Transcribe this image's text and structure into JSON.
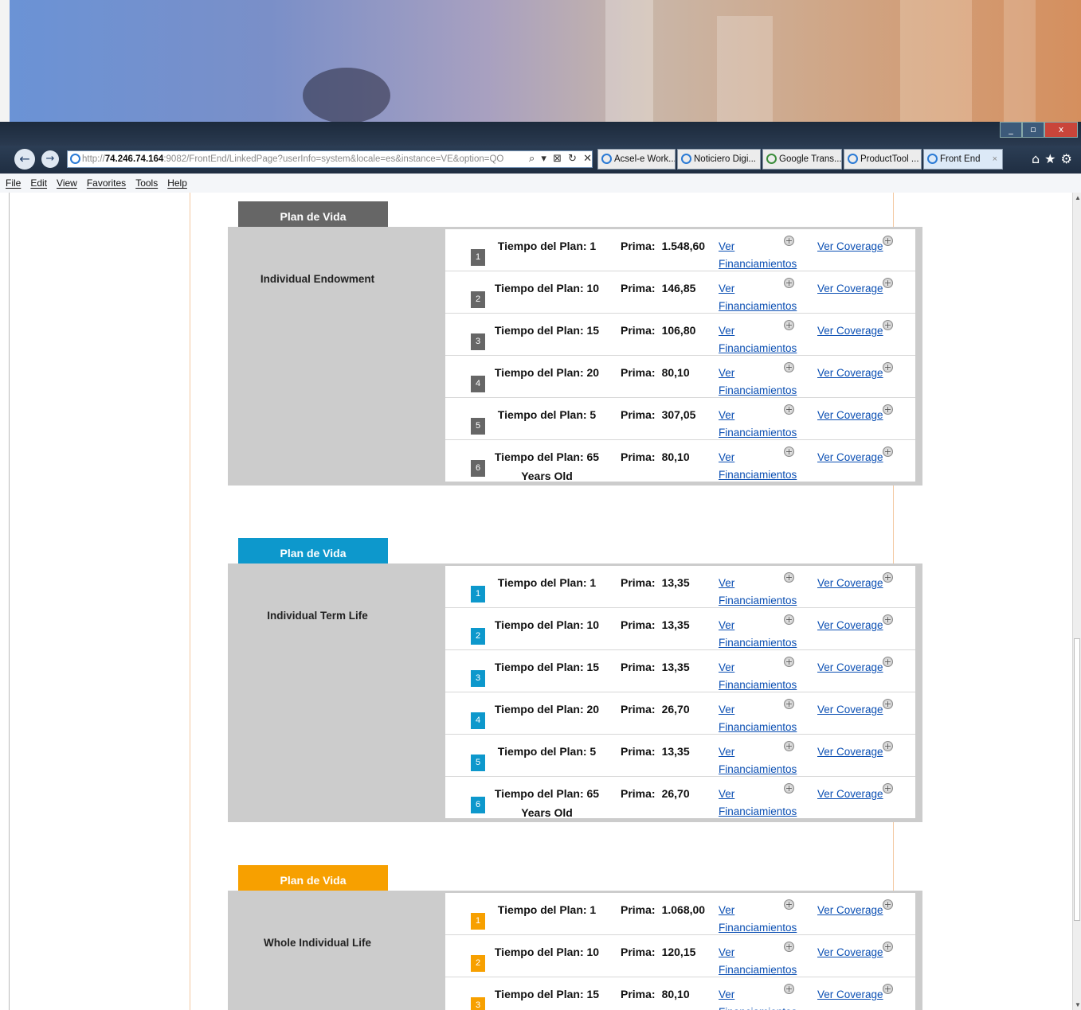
{
  "browser": {
    "url_prefix": "http://",
    "url_host": "74.246.74.164",
    "url_rest": ":9082/FrontEnd/LinkedPage?userInfo=system&locale=es&instance=VE&option=QO",
    "addr_tools": "⌕ ▾ ⊠ ↻ ✕",
    "tabs": [
      {
        "label": "Acsel-e Work..."
      },
      {
        "label": "Noticiero Digi..."
      },
      {
        "label": "Google Trans..."
      },
      {
        "label": "ProductTool ..."
      },
      {
        "label": "Front End"
      }
    ],
    "tab_close": "×",
    "right_icons": "⌂★⚙",
    "window_controls": {
      "minimize": "_",
      "maximize": "▫",
      "close": "x"
    },
    "back": "←",
    "forward": "→"
  },
  "menu": [
    "File",
    "Edit",
    "View",
    "Favorites",
    "Tools",
    "Help"
  ],
  "plans": [
    {
      "tab_label": "Plan de Vida",
      "name": "Individual Endowment",
      "accent": "#666666",
      "rows": [
        {
          "num": "1",
          "term": "Tiempo del Plan: 1",
          "prima_label": "Prima:",
          "prima": "1.548,60",
          "fin1": "Ver",
          "fin2": "Financiamientos",
          "cov": "Ver Coverage"
        },
        {
          "num": "2",
          "term": "Tiempo del Plan: 10",
          "prima_label": "Prima:",
          "prima": "146,85",
          "fin1": "Ver",
          "fin2": "Financiamientos",
          "cov": "Ver Coverage"
        },
        {
          "num": "3",
          "term": "Tiempo del Plan: 15",
          "prima_label": "Prima:",
          "prima": "106,80",
          "fin1": "Ver",
          "fin2": "Financiamientos",
          "cov": "Ver Coverage"
        },
        {
          "num": "4",
          "term": "Tiempo del Plan: 20",
          "prima_label": "Prima:",
          "prima": "80,10",
          "fin1": "Ver",
          "fin2": "Financiamientos",
          "cov": "Ver Coverage"
        },
        {
          "num": "5",
          "term": "Tiempo del Plan: 5",
          "prima_label": "Prima:",
          "prima": "307,05",
          "fin1": "Ver",
          "fin2": "Financiamientos",
          "cov": "Ver Coverage"
        },
        {
          "num": "6",
          "term": "Tiempo del Plan: 65 Years Old",
          "prima_label": "Prima:",
          "prima": "80,10",
          "fin1": "Ver",
          "fin2": "Financiamientos",
          "cov": "Ver Coverage"
        }
      ]
    },
    {
      "tab_label": "Plan de Vida",
      "name": "Individual Term Life",
      "accent": "#0d98cc",
      "rows": [
        {
          "num": "1",
          "term": "Tiempo del Plan: 1",
          "prima_label": "Prima:",
          "prima": "13,35",
          "fin1": "Ver",
          "fin2": "Financiamientos",
          "cov": "Ver Coverage"
        },
        {
          "num": "2",
          "term": "Tiempo del Plan: 10",
          "prima_label": "Prima:",
          "prima": "13,35",
          "fin1": "Ver",
          "fin2": "Financiamientos",
          "cov": "Ver Coverage"
        },
        {
          "num": "3",
          "term": "Tiempo del Plan: 15",
          "prima_label": "Prima:",
          "prima": "13,35",
          "fin1": "Ver",
          "fin2": "Financiamientos",
          "cov": "Ver Coverage"
        },
        {
          "num": "4",
          "term": "Tiempo del Plan: 20",
          "prima_label": "Prima:",
          "prima": "26,70",
          "fin1": "Ver",
          "fin2": "Financiamientos",
          "cov": "Ver Coverage"
        },
        {
          "num": "5",
          "term": "Tiempo del Plan: 5",
          "prima_label": "Prima:",
          "prima": "13,35",
          "fin1": "Ver",
          "fin2": "Financiamientos",
          "cov": "Ver Coverage"
        },
        {
          "num": "6",
          "term": "Tiempo del Plan: 65 Years Old",
          "prima_label": "Prima:",
          "prima": "26,70",
          "fin1": "Ver",
          "fin2": "Financiamientos",
          "cov": "Ver Coverage"
        }
      ]
    },
    {
      "tab_label": "Plan de Vida",
      "name": "Whole Individual Life",
      "accent": "#f7a000",
      "rows": [
        {
          "num": "1",
          "term": "Tiempo del Plan: 1",
          "prima_label": "Prima:",
          "prima": "1.068,00",
          "fin1": "Ver",
          "fin2": "Financiamientos",
          "cov": "Ver Coverage"
        },
        {
          "num": "2",
          "term": "Tiempo del Plan: 10",
          "prima_label": "Prima:",
          "prima": "120,15",
          "fin1": "Ver",
          "fin2": "Financiamientos",
          "cov": "Ver Coverage"
        },
        {
          "num": "3",
          "term": "Tiempo del Plan: 15",
          "prima_label": "Prima:",
          "prima": "80,10",
          "fin1": "Ver",
          "fin2": "Financiamientos",
          "cov": "Ver Coverage"
        }
      ]
    }
  ]
}
